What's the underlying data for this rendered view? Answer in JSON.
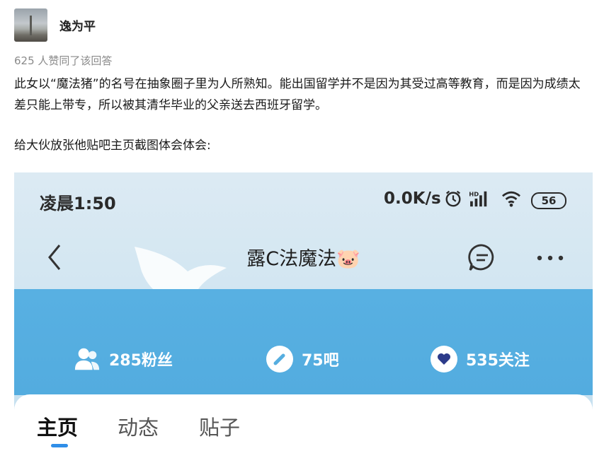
{
  "author": {
    "name": "逸为平"
  },
  "likes_text": "625 人赞同了该回答",
  "answer": {
    "paragraph1": "此女以“魔法猪”的名号在抽象圈子里为人所熟知。能出国留学并不是因为其受过高等教育，而是因为成绩太差只能上带专，所以被其清华毕业的父亲送去西班牙留学。",
    "paragraph2": "给大伙放张他贴吧主页截图体会体会:"
  },
  "screenshot": {
    "status_bar": {
      "time": "凌晨1:50",
      "net_speed": "0.0K/s",
      "battery": "56"
    },
    "nav": {
      "title": "露C法魔法🐷"
    },
    "stats": [
      {
        "icon": "fans-icon",
        "label": "285粉丝"
      },
      {
        "icon": "bar-icon",
        "label": "75吧"
      },
      {
        "icon": "heart-icon",
        "label": "535关注"
      }
    ],
    "tabs": [
      {
        "label": "主页",
        "active": true
      },
      {
        "label": "动态",
        "active": false
      },
      {
        "label": "贴子",
        "active": false
      }
    ],
    "colors": {
      "accent": "#2f8ee8",
      "band": "#56aee0"
    }
  }
}
